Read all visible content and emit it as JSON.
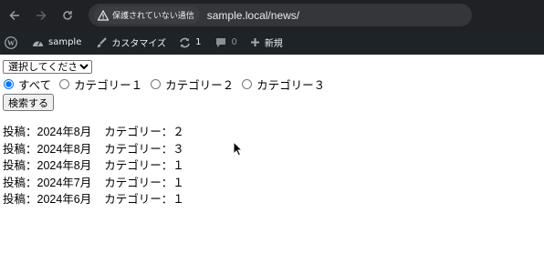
{
  "browser": {
    "security_label": "保護されていない通信",
    "url": "sample.local/news/"
  },
  "adminbar": {
    "site_name": "sample",
    "customize": "カスタマイズ",
    "updates_count": "1",
    "comments_count": "0",
    "new_label": "新規"
  },
  "form": {
    "select": {
      "selected": "選択してください"
    },
    "radios": [
      {
        "label": "すべて",
        "checked": true
      },
      {
        "label": "カテゴリー１",
        "checked": false
      },
      {
        "label": "カテゴリー２",
        "checked": false
      },
      {
        "label": "カテゴリー３",
        "checked": false
      }
    ],
    "submit_label": "検索する"
  },
  "posts": [
    {
      "date": "投稿：2024年8月",
      "category": "カテゴリー：２"
    },
    {
      "date": "投稿：2024年8月",
      "category": "カテゴリー：３"
    },
    {
      "date": "投稿：2024年8月",
      "category": "カテゴリー：１"
    },
    {
      "date": "投稿：2024年7月",
      "category": "カテゴリー：１"
    },
    {
      "date": "投稿：2024年6月",
      "category": "カテゴリー：１"
    }
  ]
}
